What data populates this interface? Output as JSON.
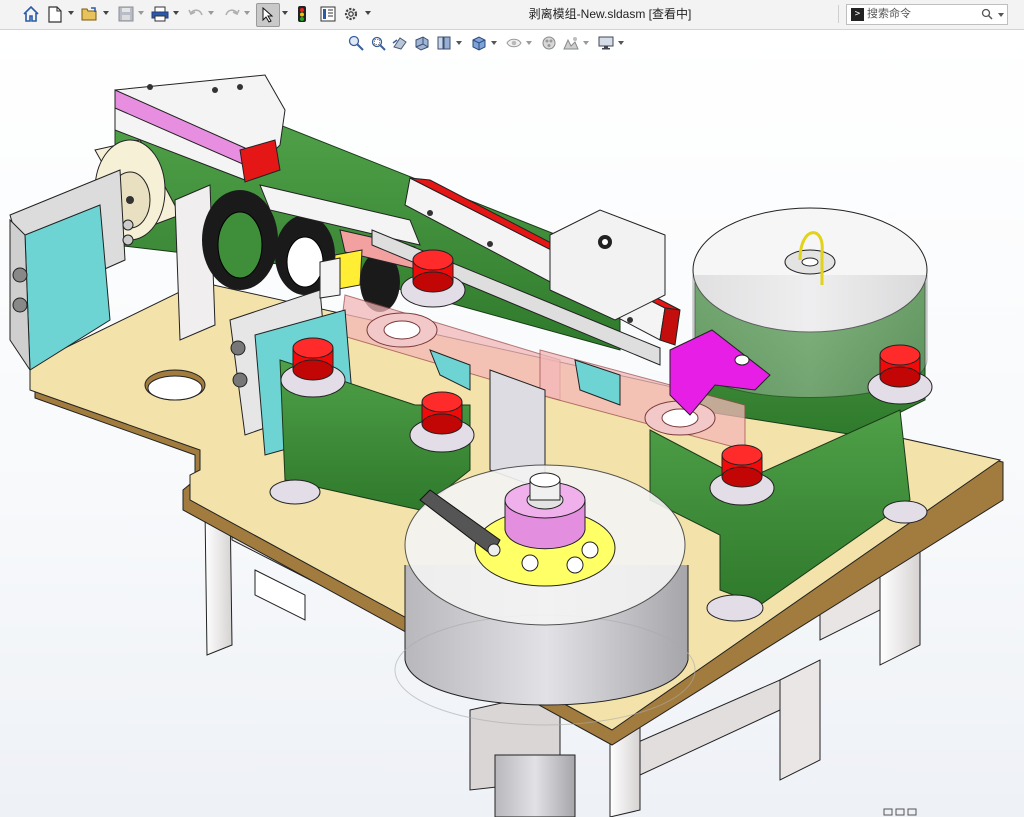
{
  "window": {
    "title": "剥离模组-New.sldasm [查看中]"
  },
  "toolbar": {
    "items": [
      "home-icon",
      "new-document-icon",
      "open-icon",
      "save-icon",
      "print-icon",
      "undo-icon",
      "redo-icon",
      "select-icon",
      "rebuild-icon",
      "file-properties-icon",
      "options-icon"
    ]
  },
  "search": {
    "placeholder": "搜索命令"
  },
  "heads_up_toolbar": {
    "items": [
      "zoom-to-fit-icon",
      "zoom-to-area-icon",
      "previous-view-icon",
      "section-view-icon",
      "view-orientation-icon",
      "display-style-icon",
      "hide-show-items-icon",
      "edit-appearance-icon",
      "apply-scene-icon",
      "view-settings-icon"
    ]
  },
  "model": {
    "name": "剥离模组-New",
    "colors": {
      "base_plate": "#f2e3a8",
      "base_plate_edge": "#a07a3c",
      "frame": "#e8e4e4",
      "green_body": "#3f8f3a",
      "red_cap": "#f20a0a",
      "cyan_block": "#6dd3d3",
      "magenta_part": "#e61ee6",
      "pink_part": "#e891e0",
      "yellow_part": "#ffff4a",
      "rail_red": "#e51616",
      "drum_white": "#f7f7f7",
      "drum_gray": "#c8c8cc"
    }
  }
}
